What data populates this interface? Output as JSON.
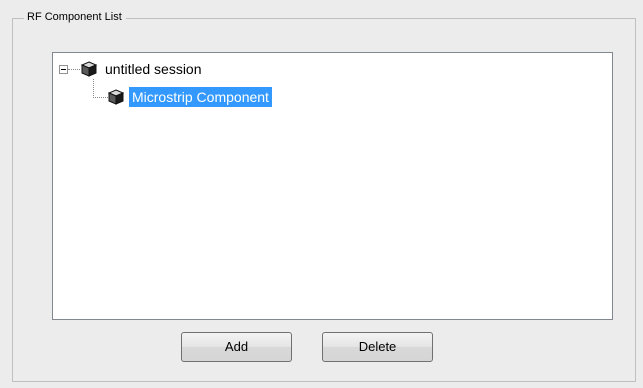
{
  "panel": {
    "title": "RF Component List"
  },
  "tree": {
    "root": {
      "label": "untitled session",
      "icon": "cube-icon",
      "expanded": true
    },
    "children": [
      {
        "label": "Microstrip Component",
        "icon": "cube-icon",
        "selected": true
      }
    ]
  },
  "buttons": {
    "add_label": "Add",
    "delete_label": "Delete"
  },
  "colors": {
    "selection": "#3399ff",
    "background": "#ececec"
  }
}
